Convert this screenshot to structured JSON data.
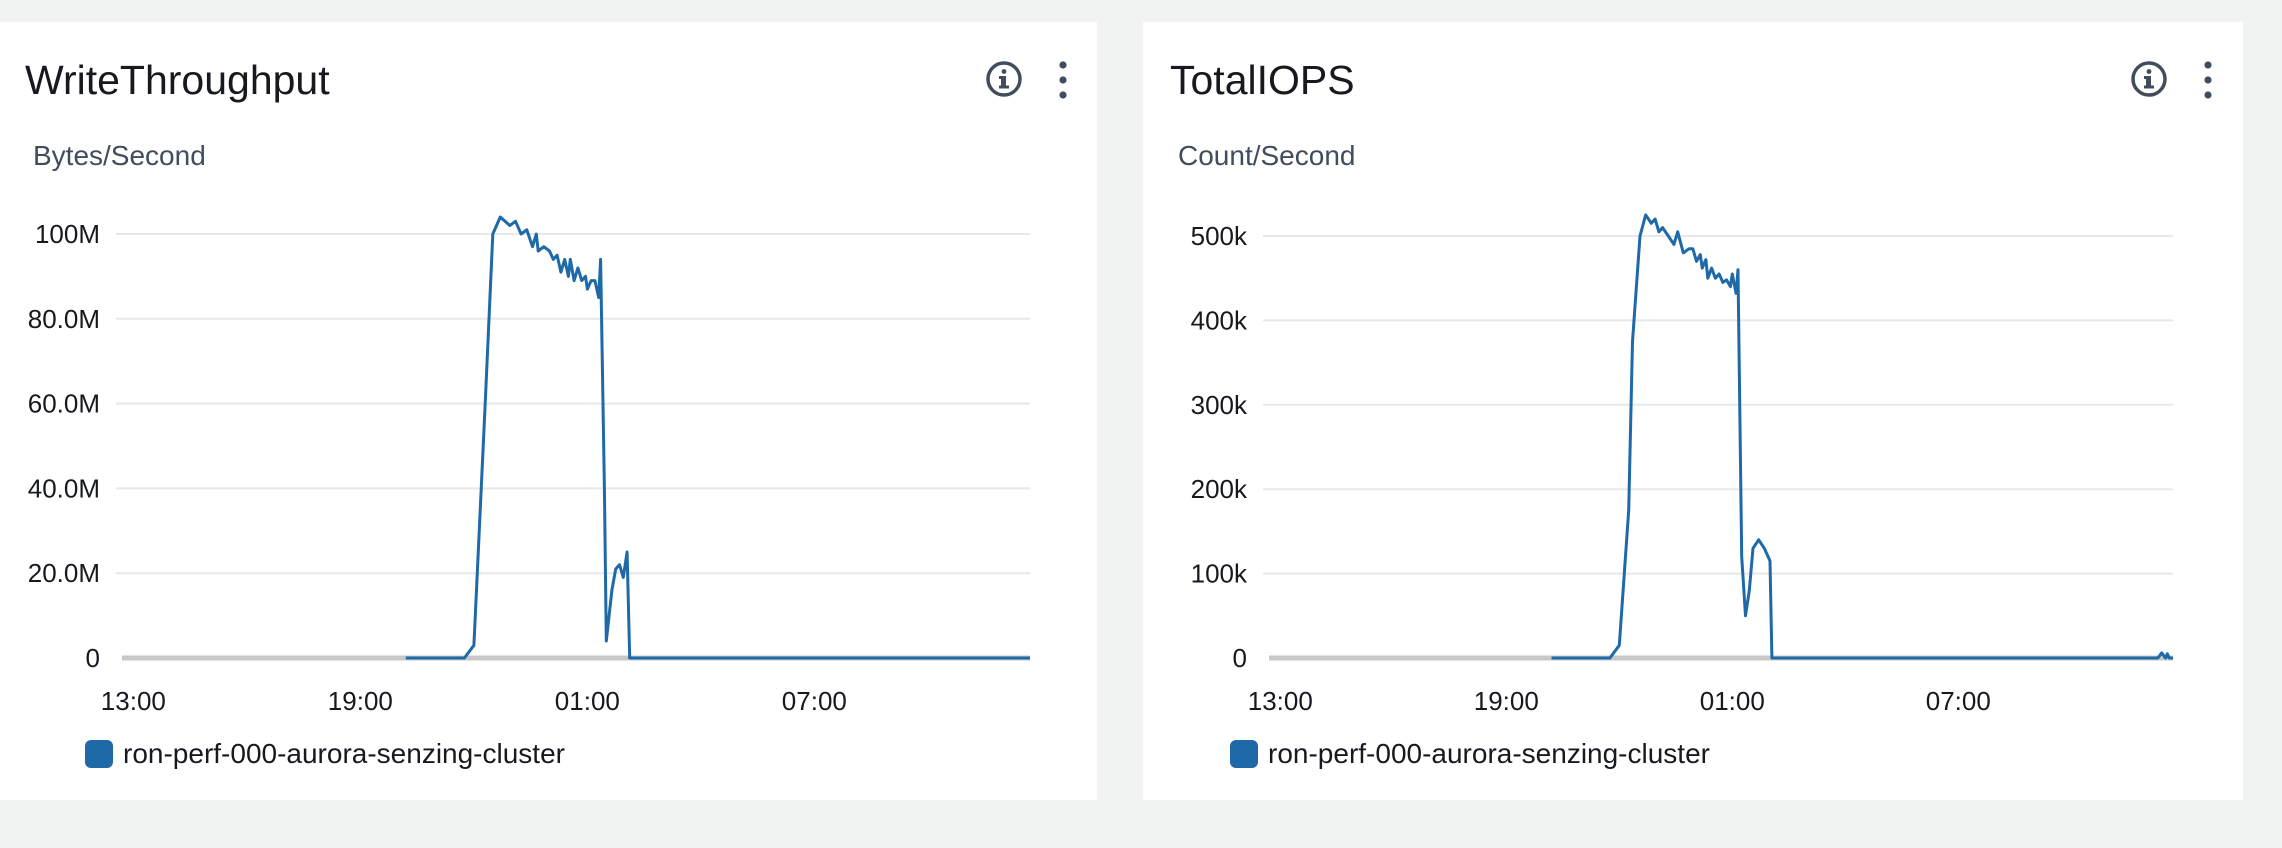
{
  "colors": {
    "series": "#1f69a8",
    "grid": "#e6e8ea",
    "baseline": "#c8c8c8",
    "icon": "#414d5c"
  },
  "widgets": [
    {
      "title": "WriteThroughput",
      "unit": "Bytes/Second",
      "info_icon": "info-icon",
      "menu_icon": "more-vertical-icon",
      "legend": "ron-perf-000-aurora-senzing-cluster",
      "chart_data": {
        "type": "line",
        "title": "WriteThroughput",
        "ylabel": "Bytes/Second",
        "xlabel": "",
        "ylim": [
          0,
          100000000
        ],
        "y_ticks": [
          "0",
          "20.0M",
          "40.0M",
          "60.0M",
          "80.0M",
          "100M"
        ],
        "y_tick_values": [
          0,
          20000000,
          40000000,
          60000000,
          80000000,
          100000000
        ],
        "x_ticks": [
          "13:00",
          "19:00",
          "01:00",
          "07:00"
        ],
        "x_tick_hours": [
          0,
          6,
          12,
          18
        ],
        "xlim_hours": [
          -0.3,
          23.7
        ],
        "grid": true,
        "legend_position": "bottom-left",
        "series": [
          {
            "name": "ron-perf-000-aurora-senzing-cluster",
            "points": [
              [
                7.2,
                0
              ],
              [
                8.75,
                0
              ],
              [
                9.0,
                3000000
              ],
              [
                9.3,
                60000000
              ],
              [
                9.5,
                100000000
              ],
              [
                9.7,
                104000000
              ],
              [
                9.95,
                102000000
              ],
              [
                10.1,
                103000000
              ],
              [
                10.25,
                100000000
              ],
              [
                10.4,
                101000000
              ],
              [
                10.55,
                97000000
              ],
              [
                10.65,
                100000000
              ],
              [
                10.7,
                96000000
              ],
              [
                10.85,
                97000000
              ],
              [
                11.0,
                96000000
              ],
              [
                11.1,
                94000000
              ],
              [
                11.2,
                95000000
              ],
              [
                11.3,
                91000000
              ],
              [
                11.4,
                94000000
              ],
              [
                11.5,
                90000000
              ],
              [
                11.55,
                94000000
              ],
              [
                11.65,
                89000000
              ],
              [
                11.75,
                92000000
              ],
              [
                11.85,
                89000000
              ],
              [
                11.95,
                90000000
              ],
              [
                12.0,
                87000000
              ],
              [
                12.1,
                89000000
              ],
              [
                12.2,
                89000000
              ],
              [
                12.3,
                85000000
              ],
              [
                12.35,
                94000000
              ],
              [
                12.45,
                40000000
              ],
              [
                12.5,
                4000000
              ],
              [
                12.65,
                16000000
              ],
              [
                12.75,
                21000000
              ],
              [
                12.85,
                22000000
              ],
              [
                12.95,
                19000000
              ],
              [
                13.05,
                25000000
              ],
              [
                13.12,
                0
              ],
              [
                23.7,
                0
              ]
            ]
          }
        ]
      }
    },
    {
      "title": "TotalIOPS",
      "unit": "Count/Second",
      "info_icon": "info-icon",
      "menu_icon": "more-vertical-icon",
      "legend": "ron-perf-000-aurora-senzing-cluster",
      "chart_data": {
        "type": "line",
        "title": "TotalIOPS",
        "ylabel": "Count/Second",
        "xlabel": "",
        "ylim": [
          0,
          500000
        ],
        "y_ticks": [
          "0",
          "100k",
          "200k",
          "300k",
          "400k",
          "500k"
        ],
        "y_tick_values": [
          0,
          100000,
          200000,
          300000,
          400000,
          500000
        ],
        "x_ticks": [
          "13:00",
          "19:00",
          "01:00",
          "07:00"
        ],
        "x_tick_hours": [
          0,
          6,
          12,
          18
        ],
        "xlim_hours": [
          -0.3,
          23.7
        ],
        "grid": true,
        "legend_position": "bottom-left",
        "series": [
          {
            "name": "ron-perf-000-aurora-senzing-cluster",
            "points": [
              [
                7.2,
                0
              ],
              [
                8.75,
                0
              ],
              [
                9.0,
                15000
              ],
              [
                9.25,
                175000
              ],
              [
                9.35,
                375000
              ],
              [
                9.55,
                500000
              ],
              [
                9.7,
                525000
              ],
              [
                9.85,
                515000
              ],
              [
                9.95,
                520000
              ],
              [
                10.05,
                505000
              ],
              [
                10.15,
                510000
              ],
              [
                10.3,
                500000
              ],
              [
                10.45,
                490000
              ],
              [
                10.55,
                505000
              ],
              [
                10.7,
                480000
              ],
              [
                10.85,
                485000
              ],
              [
                10.95,
                485000
              ],
              [
                11.05,
                470000
              ],
              [
                11.15,
                478000
              ],
              [
                11.2,
                462000
              ],
              [
                11.3,
                472000
              ],
              [
                11.35,
                450000
              ],
              [
                11.45,
                462000
              ],
              [
                11.55,
                450000
              ],
              [
                11.65,
                455000
              ],
              [
                11.75,
                445000
              ],
              [
                11.85,
                448000
              ],
              [
                11.95,
                440000
              ],
              [
                12.0,
                455000
              ],
              [
                12.1,
                432000
              ],
              [
                12.15,
                460000
              ],
              [
                12.25,
                120000
              ],
              [
                12.35,
                50000
              ],
              [
                12.45,
                80000
              ],
              [
                12.55,
                130000
              ],
              [
                12.7,
                140000
              ],
              [
                12.85,
                130000
              ],
              [
                13.0,
                115000
              ],
              [
                13.05,
                0
              ],
              [
                23.3,
                0
              ],
              [
                23.4,
                6000
              ],
              [
                23.5,
                0
              ],
              [
                23.55,
                5000
              ],
              [
                23.6,
                0
              ],
              [
                23.7,
                0
              ]
            ]
          }
        ]
      }
    }
  ]
}
